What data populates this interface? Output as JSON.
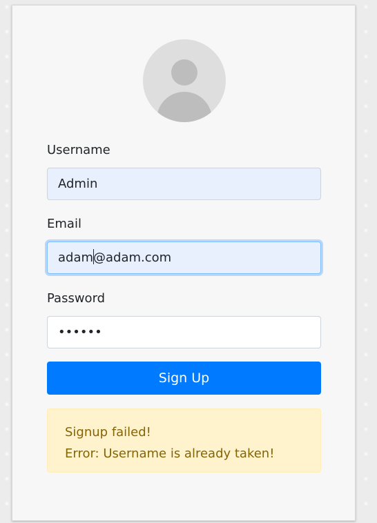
{
  "form": {
    "username_label": "Username",
    "username_value": "Admin",
    "email_label": "Email",
    "email_value_before_caret": "adam",
    "email_value_after_caret": "@adam.com",
    "password_label": "Password",
    "password_value": "••••••",
    "submit_label": "Sign Up"
  },
  "alert": {
    "title": "Signup failed!",
    "message": "Error: Username is already taken!"
  },
  "icons": {
    "avatar": "user-avatar-icon"
  },
  "colors": {
    "primary": "#007bff",
    "alert_bg": "#fff3cd",
    "alert_text": "#856404",
    "autofill_bg": "#e8f0fe"
  }
}
